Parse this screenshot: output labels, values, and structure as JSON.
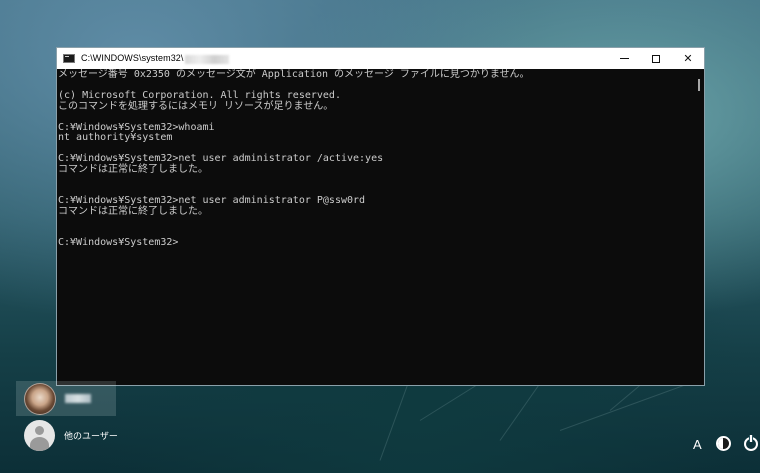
{
  "window": {
    "title": "C:\\WINDOWS\\system32\\",
    "controls": {
      "minimize": "minimize-icon",
      "maximize": "maximize-icon",
      "close": "✕"
    }
  },
  "console": {
    "lines": [
      "メッセージ番号 0x2350 のメッセージ文が Application のメッセージ ファイルに見つかりません。",
      "",
      "(c) Microsoft Corporation. All rights reserved.",
      "このコマンドを処理するにはメモリ リソースが足りません。",
      "",
      "C:¥Windows¥System32>whoami",
      "nt authority¥system",
      "",
      "C:¥Windows¥System32>net user administrator /active:yes",
      "コマンドは正常に終了しました。",
      "",
      "",
      "C:¥Windows¥System32>net user administrator P@ssw0rd",
      "コマンドは正常に終了しました。",
      "",
      "",
      "C:¥Windows¥System32>"
    ]
  },
  "users": {
    "other_label": "他のユーザー"
  },
  "system_tray": {
    "ime_indicator": "A",
    "ease_of_access_icon": "ease-of-access-icon",
    "power_icon": "power-icon"
  },
  "colors": {
    "console_bg": "#0c0c0c",
    "console_text": "#cccccc",
    "titlebar_bg": "#ffffff"
  }
}
